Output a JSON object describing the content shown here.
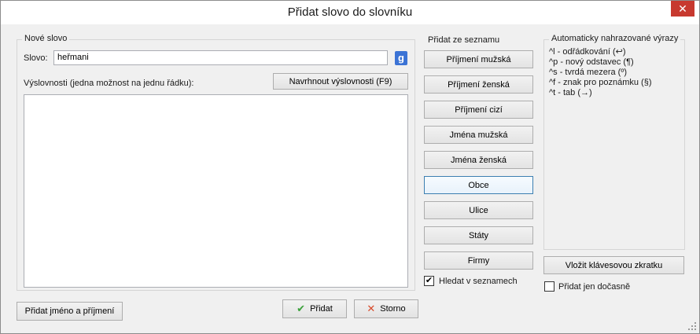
{
  "window": {
    "title": "Přidat slovo do slovníku",
    "close_glyph": "✕"
  },
  "nove_slovo": {
    "legend": "Nové slovo",
    "slovo_label": "Slovo:",
    "slovo_value": "heřmani",
    "google_glyph": "g",
    "vyslovnosti_label": "Výslovnosti (jedna možnost na jednu řádku):",
    "suggest_button": "Navrhnout výslovnosti (F9)"
  },
  "seznam": {
    "legend": "Přidat ze seznamu",
    "buttons": [
      "Příjmení mužská",
      "Příjmení ženská",
      "Příjmení cizí",
      "Jména mužská",
      "Jména ženská",
      "Obce",
      "Ulice",
      "Státy",
      "Firmy"
    ],
    "search_checkbox_label": "Hledat v seznamech",
    "search_checked": true
  },
  "auto": {
    "legend": "Automaticky nahrazované výrazy",
    "items": [
      "^l - odřádkování (↩)",
      "^p - nový odstavec (¶)",
      "^s - tvrdá mezera (º)",
      "^f - znak pro poznámku (§)",
      "^t - tab (→)"
    ],
    "shortcut_button": "Vložit klávesovou zkratku",
    "temp_checkbox_label": "Přidat jen dočasně",
    "temp_checked": false
  },
  "footer": {
    "add_name_button": "Přidat jméno a příjmení",
    "ok_button": "Přidat",
    "cancel_button": "Storno"
  },
  "colors": {
    "accent": "#3b73d5",
    "close": "#c7392f",
    "ok_icon": "#3aa13a",
    "cancel_icon": "#d84a2a"
  }
}
